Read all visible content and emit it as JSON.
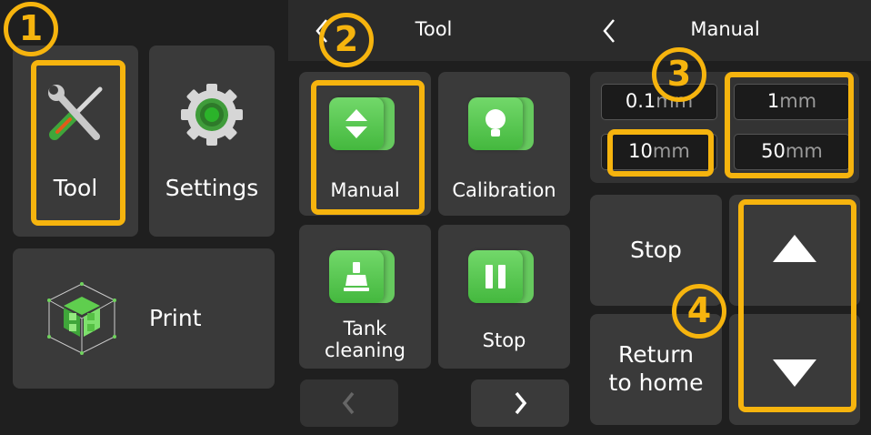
{
  "accent": "#f6b40e",
  "panel1": {
    "tool_label": "Tool",
    "settings_label": "Settings",
    "print_label": "Print",
    "badge": "1"
  },
  "panel2": {
    "title": "Tool",
    "badge": "2",
    "manual_label": "Manual",
    "calibration_label": "Calibration",
    "tank_label_1": "Tank",
    "tank_label_2": "cleaning",
    "stop_label": "Stop"
  },
  "panel3": {
    "title": "Manual",
    "badge3": "3",
    "badge4": "4",
    "steps": [
      {
        "value": "0.1",
        "unit": "mm"
      },
      {
        "value": "1",
        "unit": "mm"
      },
      {
        "value": "10",
        "unit": "mm"
      },
      {
        "value": "50",
        "unit": "mm"
      }
    ],
    "stop_label": "Stop",
    "home_label_1": "Return",
    "home_label_2": "to home"
  }
}
